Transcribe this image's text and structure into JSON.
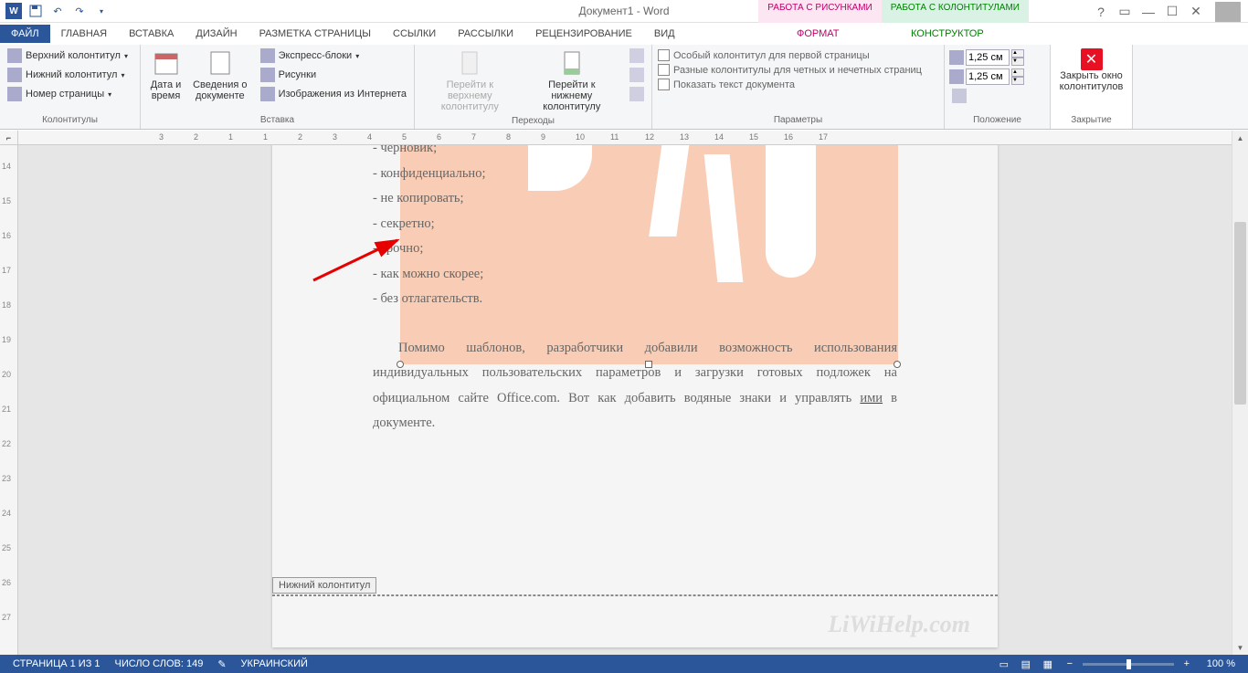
{
  "title": "Документ1 - Word",
  "contextTabs": {
    "pictures": "РАБОТА С РИСУНКАМИ",
    "headerFooter": "РАБОТА С КОЛОНТИТУЛАМИ"
  },
  "tabs": {
    "file": "ФАЙЛ",
    "home": "ГЛАВНАЯ",
    "insert": "ВСТАВКА",
    "design": "ДИЗАЙН",
    "layout": "РАЗМЕТКА СТРАНИЦЫ",
    "refs": "ССЫЛКИ",
    "mailings": "РАССЫЛКИ",
    "review": "РЕЦЕНЗИРОВАНИЕ",
    "view": "ВИД",
    "format": "ФОРМАТ",
    "constructor": "КОНСТРУКТОР"
  },
  "ribbon": {
    "g1": {
      "title": "Колонтитулы",
      "header": "Верхний колонтитул",
      "footer": "Нижний колонтитул",
      "pageNum": "Номер страницы"
    },
    "g2": {
      "title": "Вставка",
      "dateTime": "Дата и время",
      "docInfo": "Сведения о документе",
      "quick": "Экспресс-блоки",
      "images": "Рисунки",
      "online": "Изображения из Интернета"
    },
    "g3": {
      "title": "Переходы",
      "gotoHeader": "Перейти к верхнему колонтитулу",
      "gotoFooter": "Перейти к нижнему колонтитулу"
    },
    "g4": {
      "title": "Параметры",
      "firstPage": "Особый колонтитул для первой страницы",
      "oddEven": "Разные колонтитулы для четных и нечетных страниц",
      "showDoc": "Показать текст документа"
    },
    "g5": {
      "title": "Положение",
      "top": "1,25 см",
      "bottom": "1,25 см"
    },
    "g6": {
      "title": "Закрытие",
      "close1": "Закрыть окно",
      "close2": "колонтитулов"
    }
  },
  "doc": {
    "items": [
      "- черновик;",
      "- конфиденциально;",
      "- не копировать;",
      "- секретно;",
      "- срочно;",
      "- как можно скорее;",
      "- без отлагательств."
    ],
    "para1a": "Помимо шаблонов, разработчики добавили возможность использования индивидуальных пользовательских параметров и загрузки готовых подложек на официальном сайте Office.com. Вот как добавить водяные знаки и управлять ",
    "para1u": "ими",
    "para1b": " в документе.",
    "footerLabel": "Нижний колонтитул",
    "siteMark": "LiWiHelp.com"
  },
  "status": {
    "page": "СТРАНИЦА 1 ИЗ 1",
    "words": "ЧИСЛО СЛОВ: 149",
    "lang": "УКРАИНСКИЙ",
    "zoom": "100 %"
  },
  "ruler": {
    "h": [
      "3",
      "2",
      "1",
      "1",
      "2",
      "3",
      "4",
      "5",
      "6",
      "7",
      "8",
      "9",
      "10",
      "11",
      "12",
      "13",
      "14",
      "15",
      "16",
      "17"
    ],
    "v": [
      "14",
      "15",
      "16",
      "17",
      "18",
      "19",
      "20",
      "21",
      "22",
      "23",
      "24",
      "25",
      "26",
      "27"
    ]
  }
}
